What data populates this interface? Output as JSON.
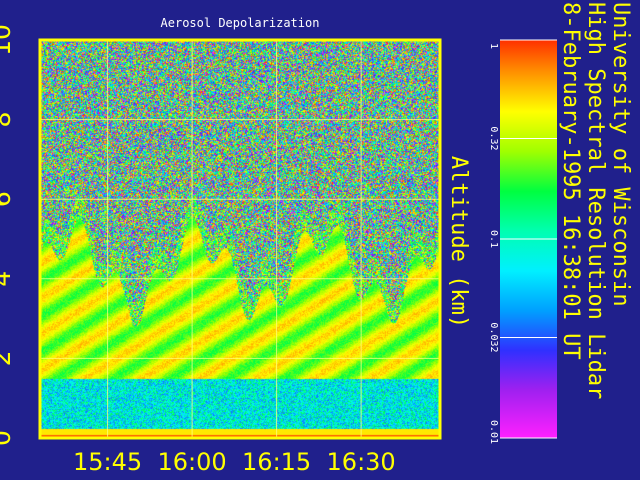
{
  "chart_data": {
    "type": "heatmap",
    "title": "Aerosol Depolarization",
    "ylabel": "Altitude (km)",
    "ylim": [
      0,
      10
    ],
    "y_ticks": [
      "0",
      "2",
      "4",
      "6",
      "8",
      "10"
    ],
    "x_tick_labels": [
      "15:45",
      "16:00",
      "16:15",
      "16:30"
    ],
    "x_tick_positions_min": [
      15,
      30,
      45,
      60
    ],
    "xlim_min": [
      3,
      74
    ],
    "grid": true,
    "colorbar": {
      "scale": "log",
      "range": [
        0.01,
        1
      ],
      "tick_labels": [
        "1",
        "0.32",
        "0.1",
        "0.032",
        "0.01"
      ],
      "tick_values": [
        1,
        0.32,
        0.1,
        0.032,
        0.01
      ]
    },
    "side_text": [
      "University of Wisconsin",
      "High Spectral Resolution Lidar",
      "8-February-1995 16:38:01 UT"
    ]
  },
  "colors": {
    "background": "#20208c",
    "frame": "#ffff00",
    "grid": "#ffff80",
    "text": "#ffff00"
  }
}
